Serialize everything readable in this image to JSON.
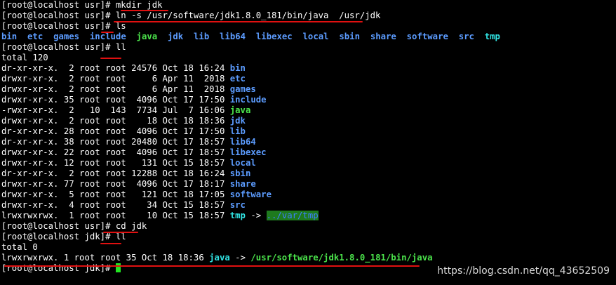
{
  "terminal": {
    "lines": [
      [
        {
          "text": "[root@localhost usr]# mkdir jdk",
          "cls": ""
        }
      ],
      [
        {
          "text": "[root@localhost usr]# ln -s /usr/software/jdk1.8.0_181/bin/java  /usr/jdk",
          "cls": ""
        }
      ],
      [
        {
          "text": "[root@localhost usr]# ls",
          "cls": ""
        }
      ],
      [
        {
          "text": "bin",
          "cls": "dir"
        },
        {
          "text": "  ",
          "cls": ""
        },
        {
          "text": "etc",
          "cls": "dir"
        },
        {
          "text": "  ",
          "cls": ""
        },
        {
          "text": "games",
          "cls": "dir"
        },
        {
          "text": "  ",
          "cls": ""
        },
        {
          "text": "include",
          "cls": "dir"
        },
        {
          "text": "  ",
          "cls": ""
        },
        {
          "text": "java",
          "cls": "exe"
        },
        {
          "text": "  ",
          "cls": ""
        },
        {
          "text": "jdk",
          "cls": "dir"
        },
        {
          "text": "  ",
          "cls": ""
        },
        {
          "text": "lib",
          "cls": "dir"
        },
        {
          "text": "  ",
          "cls": ""
        },
        {
          "text": "lib64",
          "cls": "dir"
        },
        {
          "text": "  ",
          "cls": ""
        },
        {
          "text": "libexec",
          "cls": "dir"
        },
        {
          "text": "  ",
          "cls": ""
        },
        {
          "text": "local",
          "cls": "dir"
        },
        {
          "text": "  ",
          "cls": ""
        },
        {
          "text": "sbin",
          "cls": "dir"
        },
        {
          "text": "  ",
          "cls": ""
        },
        {
          "text": "share",
          "cls": "dir"
        },
        {
          "text": "  ",
          "cls": ""
        },
        {
          "text": "software",
          "cls": "dir"
        },
        {
          "text": "  ",
          "cls": ""
        },
        {
          "text": "src",
          "cls": "dir"
        },
        {
          "text": "  ",
          "cls": ""
        },
        {
          "text": "tmp",
          "cls": "link"
        }
      ],
      [
        {
          "text": "[root@localhost usr]# ll",
          "cls": ""
        }
      ],
      [
        {
          "text": "total 120",
          "cls": ""
        }
      ],
      [
        {
          "text": "dr-xr-xr-x.  2 root root 24576 Oct 18 16:24 ",
          "cls": ""
        },
        {
          "text": "bin",
          "cls": "dir"
        }
      ],
      [
        {
          "text": "drwxr-xr-x.  2 root root     6 Apr 11  2018 ",
          "cls": ""
        },
        {
          "text": "etc",
          "cls": "dir"
        }
      ],
      [
        {
          "text": "drwxr-xr-x.  2 root root     6 Apr 11  2018 ",
          "cls": ""
        },
        {
          "text": "games",
          "cls": "dir"
        }
      ],
      [
        {
          "text": "drwxr-xr-x. 35 root root  4096 Oct 17 17:50 ",
          "cls": ""
        },
        {
          "text": "include",
          "cls": "dir"
        }
      ],
      [
        {
          "text": "-rwxr-xr-x.  2   10  143  7734 Jul  7 16:06 ",
          "cls": ""
        },
        {
          "text": "java",
          "cls": "exe"
        }
      ],
      [
        {
          "text": "drwxr-xr-x.  2 root root    18 Oct 18 18:36 ",
          "cls": ""
        },
        {
          "text": "jdk",
          "cls": "dir"
        }
      ],
      [
        {
          "text": "dr-xr-xr-x. 28 root root  4096 Oct 17 17:50 ",
          "cls": ""
        },
        {
          "text": "lib",
          "cls": "dir"
        }
      ],
      [
        {
          "text": "dr-xr-xr-x. 38 root root 20480 Oct 17 18:57 ",
          "cls": ""
        },
        {
          "text": "lib64",
          "cls": "dir"
        }
      ],
      [
        {
          "text": "drwxr-xr-x. 22 root root  4096 Oct 17 18:57 ",
          "cls": ""
        },
        {
          "text": "libexec",
          "cls": "dir"
        }
      ],
      [
        {
          "text": "drwxr-xr-x. 12 root root   131 Oct 15 18:57 ",
          "cls": ""
        },
        {
          "text": "local",
          "cls": "dir"
        }
      ],
      [
        {
          "text": "dr-xr-xr-x.  2 root root 12288 Oct 18 16:24 ",
          "cls": ""
        },
        {
          "text": "sbin",
          "cls": "dir"
        }
      ],
      [
        {
          "text": "drwxr-xr-x. 77 root root  4096 Oct 17 18:17 ",
          "cls": ""
        },
        {
          "text": "share",
          "cls": "dir"
        }
      ],
      [
        {
          "text": "drwxr-xr-x.  5 root root   121 Oct 18 17:05 ",
          "cls": ""
        },
        {
          "text": "software",
          "cls": "dir"
        }
      ],
      [
        {
          "text": "drwxr-xr-x.  4 root root    34 Oct 15 18:57 ",
          "cls": ""
        },
        {
          "text": "src",
          "cls": "dir"
        }
      ],
      [
        {
          "text": "lrwxrwxrwx.  1 root root    10 Oct 15 18:57 ",
          "cls": ""
        },
        {
          "text": "tmp",
          "cls": "link"
        },
        {
          "text": " -> ",
          "cls": ""
        },
        {
          "text": "../var/tmp",
          "cls": "hl-bg"
        }
      ],
      [
        {
          "text": "[root@localhost usr]# cd jdk",
          "cls": ""
        }
      ],
      [
        {
          "text": "[root@localhost jdk]# ll",
          "cls": ""
        }
      ],
      [
        {
          "text": "total 0",
          "cls": ""
        }
      ],
      [
        {
          "text": "lrwxrwxrwx. 1 root root 35 Oct 18 18:36 ",
          "cls": ""
        },
        {
          "text": "java",
          "cls": "link"
        },
        {
          "text": " -> ",
          "cls": ""
        },
        {
          "text": "/usr/software/jdk1.8.0_181/bin/java",
          "cls": "exe"
        }
      ],
      [
        {
          "text": "[root@localhost jdk]# ",
          "cls": ""
        },
        {
          "text": "",
          "cls": "cursor"
        }
      ]
    ]
  },
  "watermark": "https://blog.csdn.net/qq_43652509",
  "colors": {
    "background": "#000000",
    "directory": "#5c9cff",
    "executable": "#4be34b",
    "symlink": "#31e5e5",
    "annotation_underline": "#e01010"
  }
}
